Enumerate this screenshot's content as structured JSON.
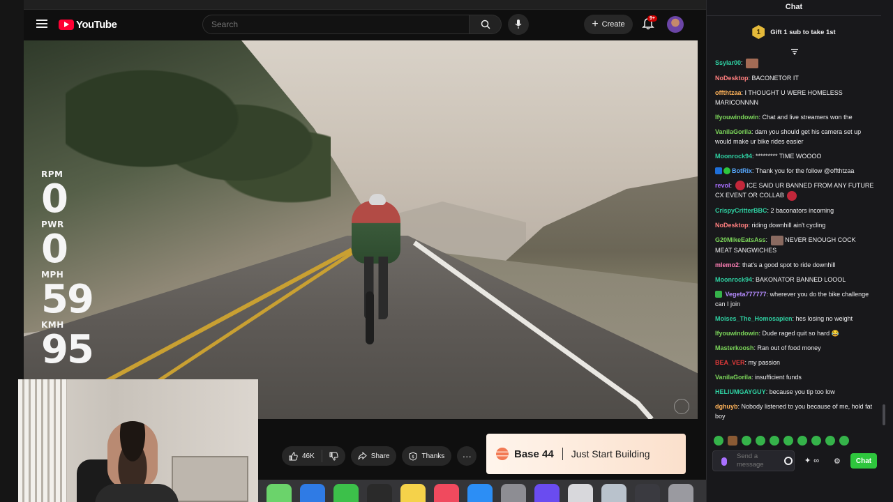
{
  "youtube": {
    "logo_text": "YouTube",
    "search_placeholder": "Search",
    "create_label": "Create",
    "notifications_badge": "9+"
  },
  "video_overlay": {
    "stats": [
      {
        "label": "RPM",
        "value": "0"
      },
      {
        "label": "PWR",
        "value": "0"
      },
      {
        "label": "MPH",
        "value": "59"
      },
      {
        "label": "KMH",
        "value": "95"
      }
    ]
  },
  "actions": {
    "like_count": "46K",
    "share_label": "Share",
    "thanks_label": "Thanks",
    "more_label": "···"
  },
  "ad": {
    "brand": "Base 44",
    "tagline": "Just Start Building"
  },
  "chat": {
    "title": "Chat",
    "gift_rank": "1",
    "gift_text": "Gift 1 sub to take 1st",
    "messages": [
      {
        "user": "Ssylar00",
        "color": "#2fd0a2",
        "text": ""
      },
      {
        "user": "NoDesktop",
        "color": "#ff7f7f",
        "text": "BACONETOR IT"
      },
      {
        "user": "offthtzaa",
        "color": "#ffb35a",
        "text": "I THOUGHT U WERE HOMELESS MARICONNNN"
      },
      {
        "user": "Ifyouwindowin",
        "color": "#7cd65a",
        "text": "Chat and live streamers won the"
      },
      {
        "user": "VanilaGorila",
        "color": "#7cd65a",
        "text": "dam you should get his camera set up would make ur bike rides easier"
      },
      {
        "user": "Moonrock94",
        "color": "#2fd0a2",
        "text": "********* TIME WOOOO"
      },
      {
        "user": "BotRix",
        "color": "#57a9ff",
        "text": "Thank you for the follow @offthtzaa"
      },
      {
        "user": "revol",
        "color": "#a970ff",
        "text": "ICE SAID UR BANNED FROM ANY FUTURE CX EVENT OR COLLAB"
      },
      {
        "user": "CrispyCritterBBC",
        "color": "#2fd0a2",
        "text": "2 baconators incoming"
      },
      {
        "user": "NoDesktop",
        "color": "#ff7f7f",
        "text": "riding downhill ain't cycling"
      },
      {
        "user": "G20MikeEatsAss",
        "color": "#7cd65a",
        "text": "NEVER ENOUGH COCK MEAT SANGWICHES"
      },
      {
        "user": "mlemo2",
        "color": "#ff7fb6",
        "text": "that's a good spot to ride downhill"
      },
      {
        "user": "Moonrock94",
        "color": "#2fd0a2",
        "text": "BAKONATOR BANNED LOOOL"
      },
      {
        "user": "Vegeta777777",
        "color": "#b58cff",
        "text": "wherever you do the bike challenge can I join"
      },
      {
        "user": "Moises_The_Homosapien",
        "color": "#2fd0a2",
        "text": "hes losing no weight"
      },
      {
        "user": "Ifyouwindowin",
        "color": "#7cd65a",
        "text": "Dude raged quit so hard 😂"
      },
      {
        "user": "Masterkoosh",
        "color": "#7cd65a",
        "text": "Ran out of food money"
      },
      {
        "user": "BEA_VER",
        "color": "#e03a3a",
        "text": "my passion"
      },
      {
        "user": "VanilaGorila",
        "color": "#7cd65a",
        "text": "insufficient funds"
      },
      {
        "user": "HELIUMGAYGUY",
        "color": "#2fd0a2",
        "text": "because you tip too low"
      },
      {
        "user": "dghuyb",
        "color": "#ffb35a",
        "text": "Nobody listened to you because of me, hold fat boy"
      }
    ],
    "input_placeholder": "Send a message",
    "points": "∞",
    "send_label": "Chat"
  }
}
